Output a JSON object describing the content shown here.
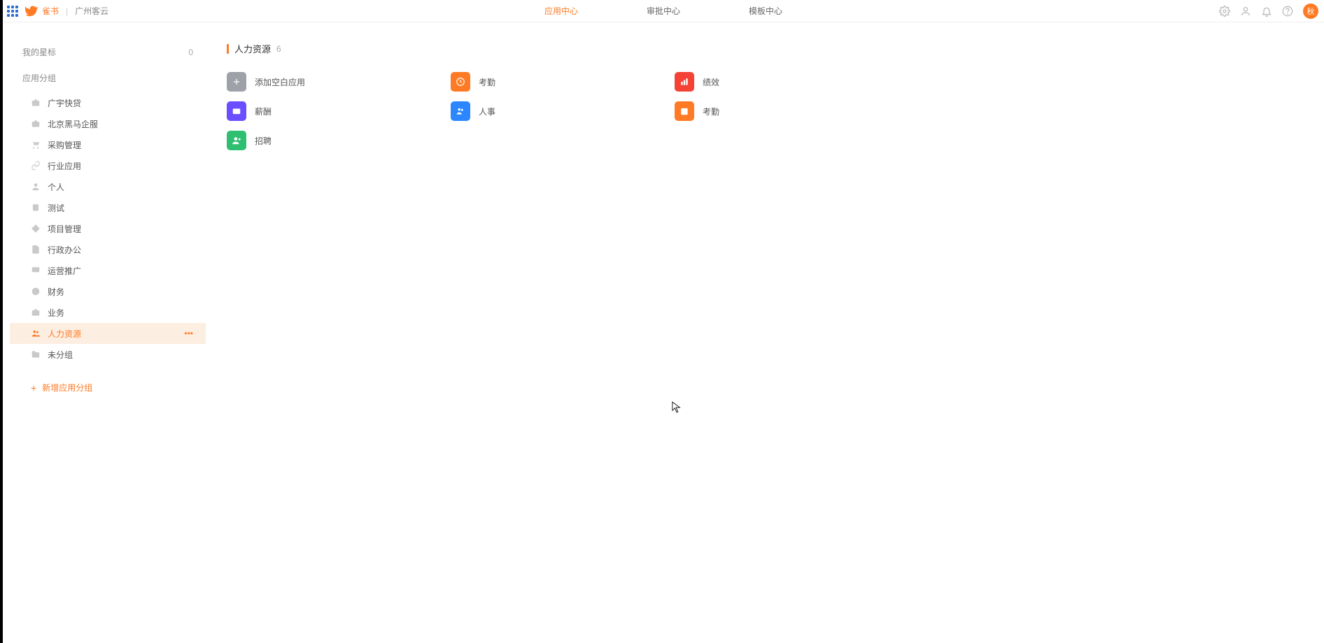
{
  "header": {
    "brand": "雀书",
    "org": "广州客云",
    "nav": [
      {
        "id": "app-center",
        "label": "应用中心",
        "active": true
      },
      {
        "id": "approve-center",
        "label": "审批中心",
        "active": false
      },
      {
        "id": "template-center",
        "label": "模板中心",
        "active": false
      }
    ],
    "avatar_text": "秋"
  },
  "sidebar": {
    "starred": {
      "label": "我的星标",
      "count": "0"
    },
    "group_header": "应用分组",
    "groups": [
      {
        "id": "g1",
        "label": "广宇快贷",
        "icon": "briefcase"
      },
      {
        "id": "g2",
        "label": "北京黑马企服",
        "icon": "briefcase"
      },
      {
        "id": "g3",
        "label": "采购管理",
        "icon": "cart"
      },
      {
        "id": "g4",
        "label": "行业应用",
        "icon": "link"
      },
      {
        "id": "g5",
        "label": "个人",
        "icon": "person"
      },
      {
        "id": "g6",
        "label": "测试",
        "icon": "note"
      },
      {
        "id": "g7",
        "label": "项目管理",
        "icon": "diamond"
      },
      {
        "id": "g8",
        "label": "行政办公",
        "icon": "doc"
      },
      {
        "id": "g9",
        "label": "运营推广",
        "icon": "monitor"
      },
      {
        "id": "g10",
        "label": "财务",
        "icon": "coin"
      },
      {
        "id": "g11",
        "label": "业务",
        "icon": "briefcase"
      },
      {
        "id": "g12",
        "label": "人力资源",
        "icon": "people",
        "active": true
      },
      {
        "id": "g13",
        "label": "未分组",
        "icon": "folder"
      }
    ],
    "add_group_label": "新增应用分组"
  },
  "main": {
    "title": "人力资源",
    "count": "6",
    "apps": [
      {
        "id": "add",
        "label": "添加空白应用",
        "icon": "plus",
        "color": "bg-add"
      },
      {
        "id": "kaoqin1",
        "label": "考勤",
        "icon": "clock",
        "color": "bg-orange"
      },
      {
        "id": "jixiao",
        "label": "绩效",
        "icon": "chart",
        "color": "bg-red"
      },
      {
        "id": "xinchou",
        "label": "薪酬",
        "icon": "wallet",
        "color": "bg-purple"
      },
      {
        "id": "renshi",
        "label": "人事",
        "icon": "team",
        "color": "bg-blue"
      },
      {
        "id": "kaoqin2",
        "label": "考勤",
        "icon": "calendar",
        "color": "bg-orange"
      },
      {
        "id": "zhaopin",
        "label": "招聘",
        "icon": "userplus",
        "color": "bg-green"
      }
    ]
  }
}
